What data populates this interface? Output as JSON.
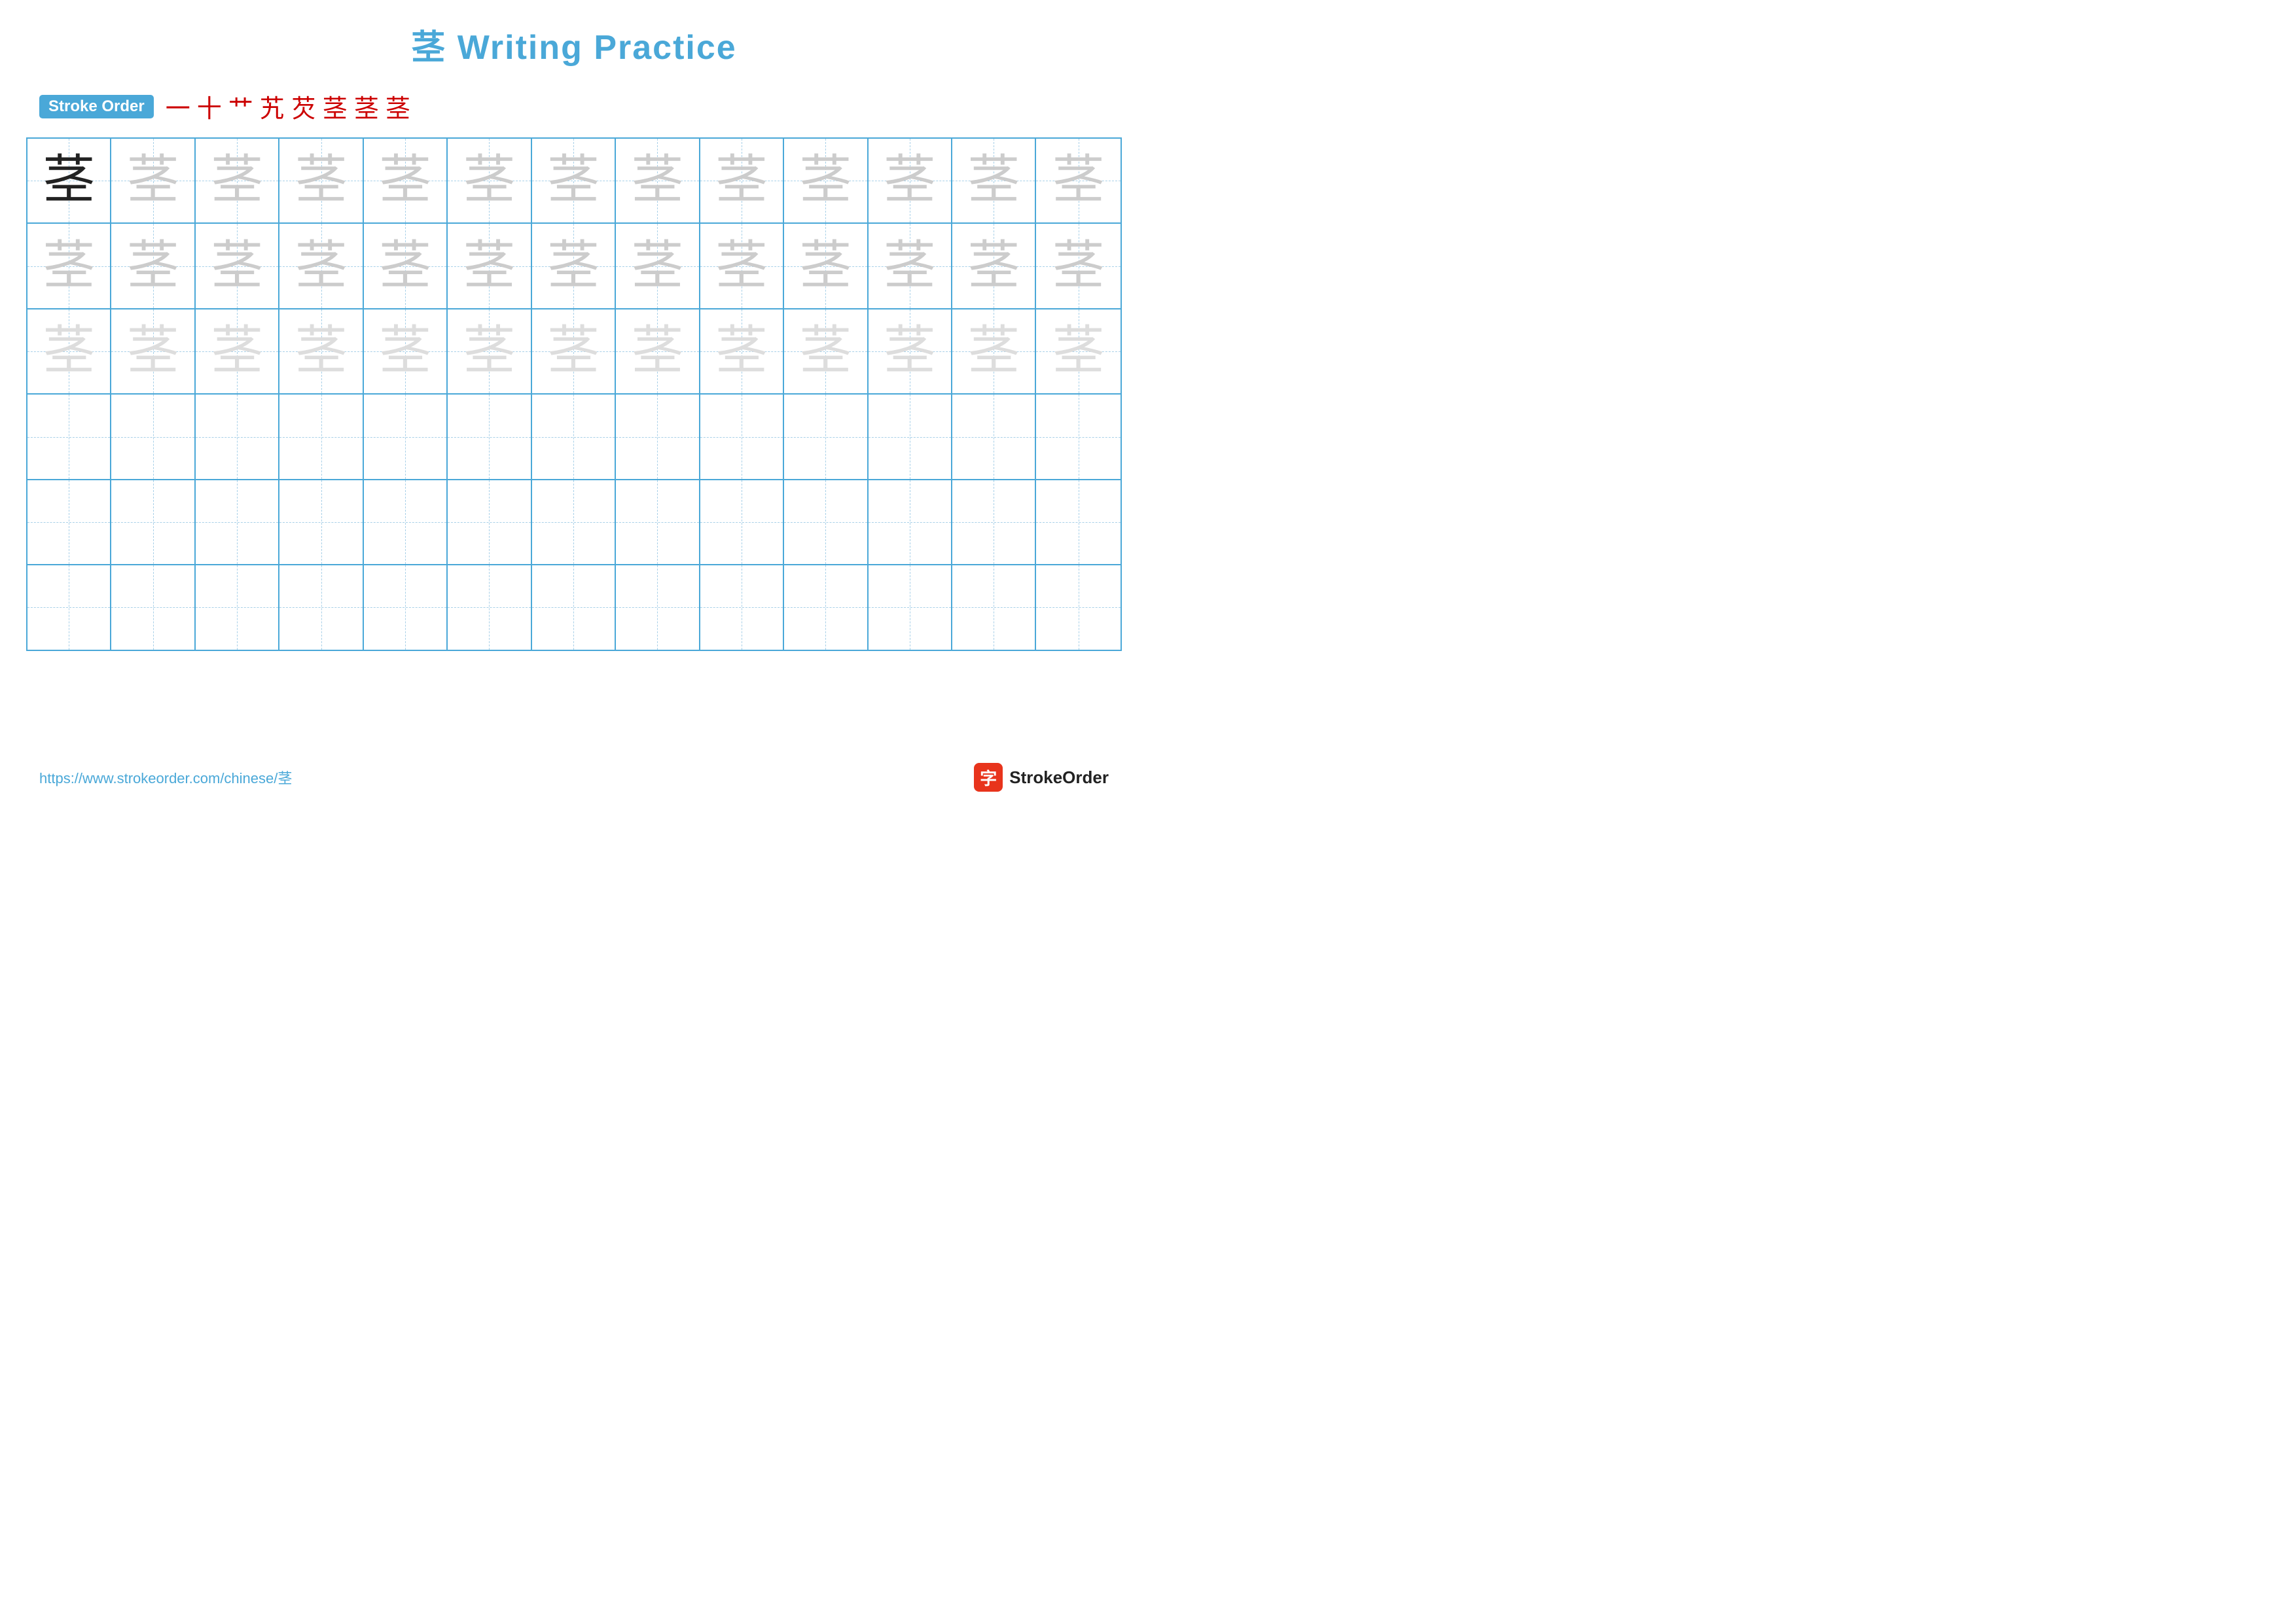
{
  "title": {
    "chinese_char": "茎",
    "text": " Writing Practice",
    "full": "茎 Writing Practice"
  },
  "stroke_order": {
    "badge_label": "Stroke Order",
    "strokes": [
      "一",
      "十",
      "艹",
      "艽",
      "芡",
      "茎",
      "茎",
      "茎"
    ]
  },
  "grid": {
    "rows": 6,
    "cols": 13,
    "character": "茎",
    "row_types": [
      "dark_then_light",
      "light",
      "lighter",
      "empty",
      "empty",
      "empty"
    ]
  },
  "footer": {
    "url": "https://www.strokeorder.com/chinese/茎",
    "logo_char": "字",
    "logo_text": "StrokeOrder"
  }
}
